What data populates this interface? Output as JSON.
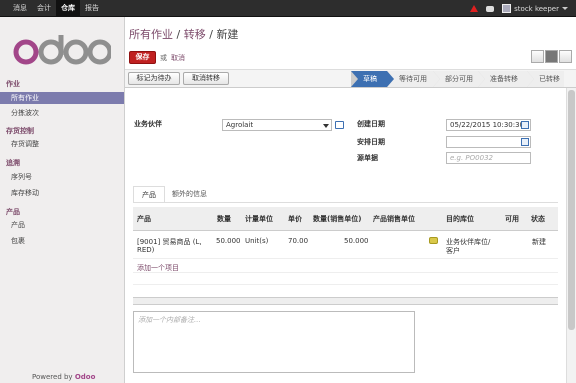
{
  "topbar": {
    "menu": [
      "消息",
      "会计",
      "仓库",
      "报告"
    ],
    "active_index": 2,
    "user": "stock keeper",
    "icons": [
      "warning-icon",
      "chat-icon"
    ],
    "colors": {
      "bar": "#2d2d2d",
      "warning": "#e02020"
    }
  },
  "sidebar": {
    "logo": "odoo",
    "sections": [
      {
        "title": "作业",
        "items": [
          "所有作业",
          "分拣波次"
        ]
      },
      {
        "title": "存货控制",
        "items": [
          "存货调整"
        ]
      },
      {
        "title": "追溯",
        "items": [
          "序列号",
          "库存移动"
        ]
      },
      {
        "title": "产品",
        "items": [
          "产品",
          "包裹"
        ]
      }
    ],
    "active_item": "所有作业",
    "powered_by": "Powered by",
    "powered_brand": "Odoo",
    "colors": {
      "section": "#7c4a6a",
      "active": "#7c7bad"
    }
  },
  "header": {
    "breadcrumb": [
      "所有作业",
      "转移",
      "新建"
    ],
    "separator": "/",
    "save": "保存",
    "or": "或",
    "cancel": "取消"
  },
  "actions": {
    "mark_todo": "标记为待办",
    "cancel_transfer": "取消转移"
  },
  "stages": [
    "草稿",
    "等待可用",
    "部分可用",
    "准备转移",
    "已转移"
  ],
  "current_stage": "草稿",
  "form": {
    "partner_label": "业务伙伴",
    "partner_value": "Agrolait",
    "created_label": "创建日期",
    "created_value": "05/22/2015 10:30:30",
    "scheduled_label": "安排日期",
    "scheduled_value": "",
    "source_label": "源单据",
    "source_placeholder": "e.g. PO0032"
  },
  "tabs": [
    "产品",
    "额外的信息"
  ],
  "active_tab": "产品",
  "table": {
    "columns": [
      "产品",
      "数量",
      "计量单位",
      "单价",
      "数量(销售单位)",
      "产品销售单位",
      "目的库位",
      "可用",
      "状态"
    ],
    "rows": [
      {
        "product_line1": "[9001] 贸易商品 (L,",
        "product_line2": "RED)",
        "qty": "50.000",
        "uom": "Unit(s)",
        "price": "70.00",
        "qty_sale": "50.000",
        "sale_uom": "",
        "dest_line1": "业务伙伴库位/",
        "dest_line2": "客户",
        "available": "",
        "status": "新建"
      }
    ],
    "add_item": "添加一个项目"
  },
  "note_placeholder": "添加一个内部备注..."
}
